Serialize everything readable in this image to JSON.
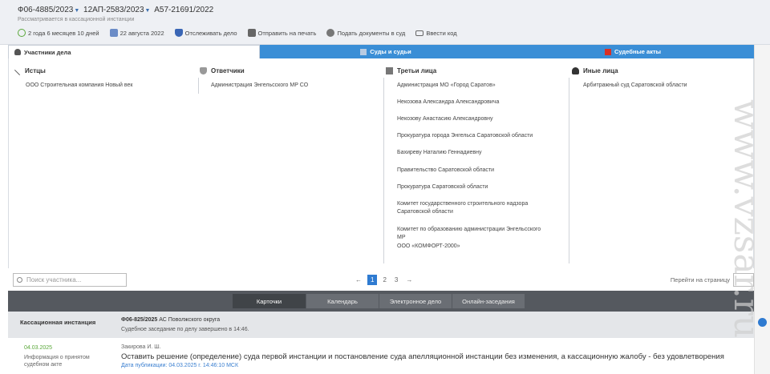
{
  "header": {
    "case1": "Ф06-4885/2023",
    "case2": "12АП-2583/2023",
    "case3": "А57-21691/2022",
    "status": "Рассматривается в кассационной инстанции",
    "actions": [
      {
        "label": "2 года 6 месяцев 10 дней",
        "icon": "clock-back-icon"
      },
      {
        "label": "22 августа 2022",
        "icon": "calendar-icon"
      },
      {
        "label": "Отслеживать дело",
        "icon": "shield-icon"
      },
      {
        "label": "Отправить на печать",
        "icon": "printer-icon"
      },
      {
        "label": "Подать документы в суд",
        "icon": "upload-icon"
      },
      {
        "label": "Ввести код",
        "icon": "code-icon"
      }
    ]
  },
  "tabs": {
    "parties": "Участники дела",
    "courts": "Суды и судьи",
    "acts": "Судебные акты"
  },
  "parties": {
    "plaintiffs": {
      "title": "Истцы",
      "items": [
        "ООО Строительная компания Новый век"
      ]
    },
    "defendants": {
      "title": "Ответчики",
      "items": [
        "Администрация Энгельсского МР СО"
      ]
    },
    "third": {
      "title": "Третьи лица",
      "items": [
        "Администрация МО «Город Саратов»",
        "Некозова Александра Александровича",
        "Некозову Анастасию Александровну",
        "Прокуратура города Энгельса Саратовской области",
        "Бахиреву Наталию Геннадиевну",
        "Правительство Саратовской области",
        "Прокуратура Саратовской области",
        "Комитет государственного строительного надзора Саратовской области",
        "Комитет по образованию администрации Энгельсского МР",
        "ООО «КОМФОРТ-2000»"
      ]
    },
    "other": {
      "title": "Иные лица",
      "items": [
        "Арбитражный суд Саратовской области"
      ]
    }
  },
  "search": {
    "placeholder": "Поиск участника..."
  },
  "pager": {
    "prev": "←",
    "pages": [
      "1",
      "2",
      "3"
    ],
    "next": "→",
    "goto": "Перейти на страницу"
  },
  "segments": [
    "Карточки",
    "Календарь",
    "Электронное дело",
    "Онлайн-заседания"
  ],
  "instance": {
    "label": "Кассационная инстанция",
    "case": "Ф06-825/2025",
    "court": "АС Поволжского округа",
    "note": "Судебное заседание по делу завершено в 14:46."
  },
  "document": {
    "date": "04.03.2025",
    "type": "Информация о принятом судебном акте",
    "judge": "Закирова И. Ш.",
    "text": "Оставить решение (определение) суда первой инстанции и постановление суда апелляционной инстанции без изменения, а кассационную жалобу - без удовлетворения",
    "published": "Дата публикации: 04.03.2025 г. 14:46:10 МСК"
  },
  "watermark": "www.vzsar.ru",
  "colors": {
    "accent": "#3a8ed6",
    "band": "#55595f",
    "link": "#3a7fd0",
    "date": "#5aa83a"
  }
}
